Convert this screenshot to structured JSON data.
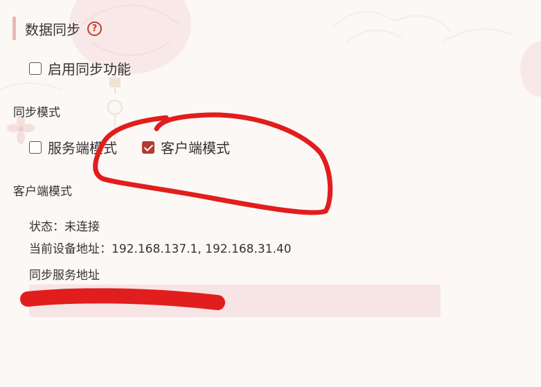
{
  "section": {
    "title": "数据同步",
    "help_icon": "question-circle-icon",
    "help_glyph": "?"
  },
  "enable_sync": {
    "label": "启用同步功能",
    "checked": false
  },
  "sync_mode": {
    "label": "同步模式",
    "options": [
      {
        "label": "服务端模式",
        "checked": false
      },
      {
        "label": "客户端模式",
        "checked": true
      }
    ]
  },
  "client_mode": {
    "label": "客户端模式",
    "status": "状态：未连接",
    "device_address": "当前设备地址：192.168.137.1, 192.168.31.40",
    "server_address_label": "同步服务地址",
    "server_address_value": ""
  },
  "colors": {
    "accent": "#b53a2f",
    "accent_bar": "#e9b9b5",
    "input_bg": "#f7e4e4",
    "annotation_red": "#e21d1d",
    "background": "#fbf8f6"
  }
}
